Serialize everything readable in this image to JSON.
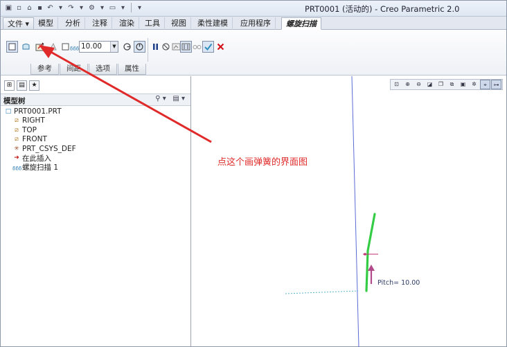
{
  "window": {
    "title": "PRT0001 (活动的) - Creo Parametric 2.0"
  },
  "quick_access": {
    "icons": [
      "app-icon",
      "new-icon",
      "open-icon",
      "save-icon",
      "undo-icon",
      "redo-icon",
      "regenerate-icon",
      "window-icon",
      "customize-icon"
    ]
  },
  "ribbon_tabs": [
    {
      "label": "文件 ▾"
    },
    {
      "label": "模型"
    },
    {
      "label": "分析"
    },
    {
      "label": "注释"
    },
    {
      "label": "渲染"
    },
    {
      "label": "工具"
    },
    {
      "label": "视图"
    },
    {
      "label": "柔性建模"
    },
    {
      "label": "应用程序"
    },
    {
      "label": "螺旋扫描"
    }
  ],
  "dashboard": {
    "pitch_value": "10.00",
    "pitch_symbol": "ᵷᵷᵷ",
    "subtabs": [
      "参考",
      "间距",
      "选项",
      "属性"
    ]
  },
  "model_tree": {
    "header": "模型树",
    "items": [
      {
        "label": "PRT0001.PRT",
        "icon": "part-icon"
      },
      {
        "label": "RIGHT",
        "icon": "datum-plane-icon"
      },
      {
        "label": "TOP",
        "icon": "datum-plane-icon"
      },
      {
        "label": "FRONT",
        "icon": "datum-plane-icon"
      },
      {
        "label": "PRT_CSYS_DEF",
        "icon": "csys-icon"
      },
      {
        "label": "在此插入",
        "icon": "insert-arrow-icon"
      },
      {
        "label": "螺旋扫描 1",
        "icon": "helical-sweep-icon"
      }
    ]
  },
  "graphics": {
    "annotation_text": "点这个画弹簧的界面图",
    "pitch_label": "Pitch= 10.00"
  },
  "colors": {
    "annotation": "#e02a2a",
    "profile": "#33cc44",
    "axis": "#5b6bd6",
    "pitch_arrow": "#b04a8a"
  }
}
